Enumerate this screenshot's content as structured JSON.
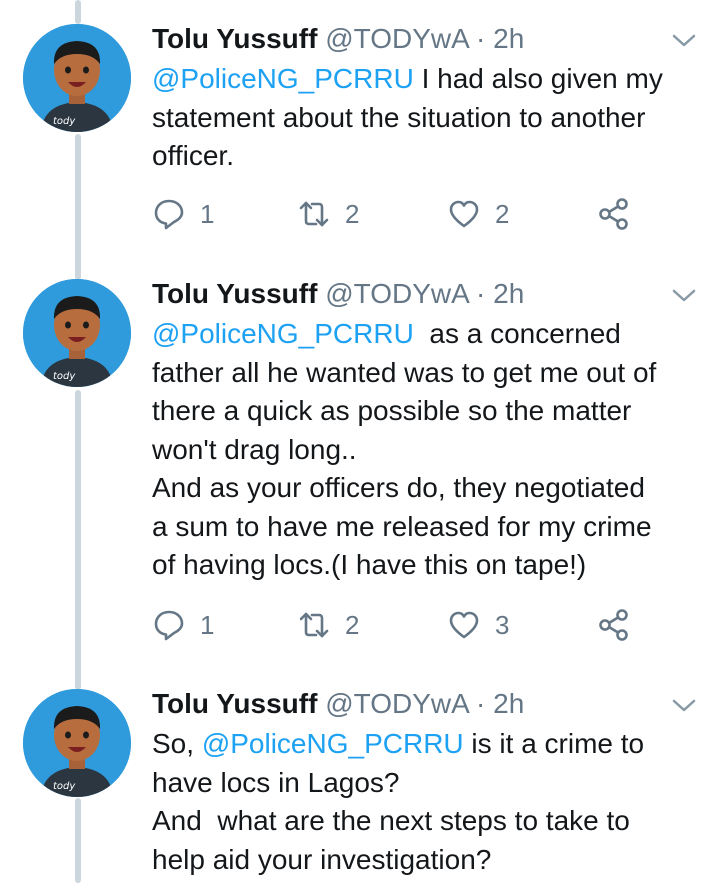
{
  "tweets": [
    {
      "name": "Tolu Yussuff",
      "handle": "@TODYwA",
      "time": "· 2h",
      "avatar_text": "tody",
      "lines": [
        {
          "mention": "@PoliceNG_PCRRU",
          "text": " I had also given my"
        },
        {
          "mention": "",
          "text": "statement about the situation to another"
        },
        {
          "mention": "",
          "text": "officer."
        }
      ],
      "replies": "1",
      "retweets": "2",
      "likes": "2"
    },
    {
      "name": "Tolu Yussuff",
      "handle": "@TODYwA",
      "time": "· 2h",
      "avatar_text": "tody",
      "lines": [
        {
          "mention": "@PoliceNG_PCRRU",
          "text": "  as a concerned"
        },
        {
          "mention": "",
          "text": "father all he wanted was to get me out of"
        },
        {
          "mention": "",
          "text": "there a quick as possible so the matter"
        },
        {
          "mention": "",
          "text": "won't drag long.."
        },
        {
          "mention": "",
          "text": "And as your officers do, they negotiated"
        },
        {
          "mention": "",
          "text": "a sum to have me released for my crime"
        },
        {
          "mention": "",
          "text": "of having locs.(I have this on tape!)"
        }
      ],
      "replies": "1",
      "retweets": "2",
      "likes": "3"
    },
    {
      "name": "Tolu Yussuff",
      "handle": "@TODYwA",
      "time": "· 2h",
      "avatar_text": "tody",
      "lines": [
        {
          "prefix": "So, ",
          "mention": "@PoliceNG_PCRRU",
          "text": " is it a crime to"
        },
        {
          "mention": "",
          "text": "have locs in Lagos?"
        },
        {
          "mention": "",
          "text": "And  what are the next steps to take to"
        },
        {
          "mention": "",
          "text": "help aid your investigation?"
        }
      ]
    }
  ],
  "colors": {
    "accent": "#1da1f2",
    "secondary_text": "#657786",
    "thread_line": "#ccd6dd",
    "avatar_bg": "#2f9bdc"
  },
  "icons": [
    "reply-icon",
    "retweet-icon",
    "like-icon",
    "share-icon",
    "chevron-down-icon"
  ]
}
